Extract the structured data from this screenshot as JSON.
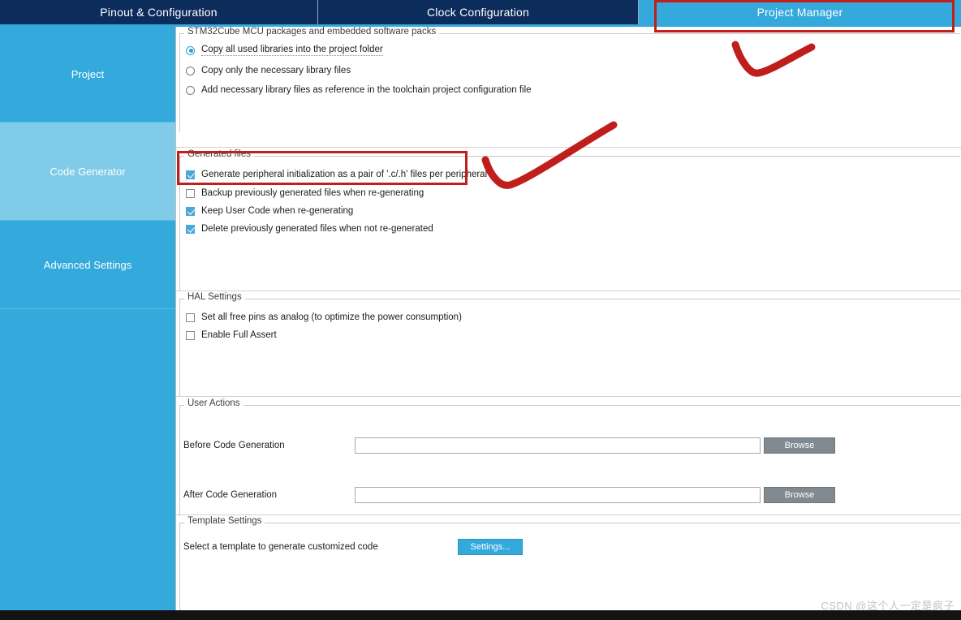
{
  "window": {
    "bottom_bar_color": "#131313"
  },
  "tabs": [
    {
      "label": "Pinout & Configuration",
      "selected": false
    },
    {
      "label": "Clock Configuration",
      "selected": false
    },
    {
      "label": "Project Manager",
      "selected": true
    }
  ],
  "sidebar": {
    "items": [
      {
        "label": "Project",
        "selected": false
      },
      {
        "label": "Code Generator",
        "selected": true
      },
      {
        "label": "Advanced Settings",
        "selected": false
      },
      {
        "label": "",
        "selected": false
      }
    ],
    "colors": {
      "normal": "#33a9dc",
      "selected": "#7fcbe8",
      "text": "#ffffff"
    }
  },
  "groups": {
    "mcu_packages": {
      "title": "STM32Cube MCU packages and embedded software packs",
      "options": [
        {
          "label": "Copy all used libraries into the project folder",
          "selected": true,
          "focused": true
        },
        {
          "label": "Copy only the necessary library files",
          "selected": false,
          "focused": false
        },
        {
          "label": "Add necessary library files as reference in the toolchain project configuration file",
          "selected": false,
          "focused": false
        }
      ]
    },
    "generated_files": {
      "title": "Generated files",
      "options": [
        {
          "label": "Generate peripheral initialization as a pair of '.c/.h' files per peripheral",
          "checked": true
        },
        {
          "label": "Backup previously generated files when re-generating",
          "checked": false
        },
        {
          "label": "Keep User Code when re-generating",
          "checked": true
        },
        {
          "label": "Delete previously generated files when not re-generated",
          "checked": true
        }
      ]
    },
    "hal_settings": {
      "title": "HAL Settings",
      "options": [
        {
          "label": "Set all free pins as analog (to optimize the power consumption)",
          "checked": false
        },
        {
          "label": "Enable Full Assert",
          "checked": false
        }
      ]
    },
    "user_actions": {
      "title": "User Actions",
      "rows": [
        {
          "label": "Before Code Generation",
          "value": "",
          "button": "Browse"
        },
        {
          "label": "After Code Generation",
          "value": "",
          "button": "Browse"
        }
      ]
    },
    "template_settings": {
      "title": "Template Settings",
      "label": "Select a template to generate customized code",
      "button": "Settings..."
    }
  },
  "annotations": {
    "color": "#c0201c",
    "highlight_tab": "Project Manager",
    "highlight_checkbox": "Generate peripheral initialization as a pair of '.c/.h' files per peripheral",
    "check_marks": 2
  },
  "watermark": {
    "text": "CSDN @这个人一定是疯子"
  }
}
